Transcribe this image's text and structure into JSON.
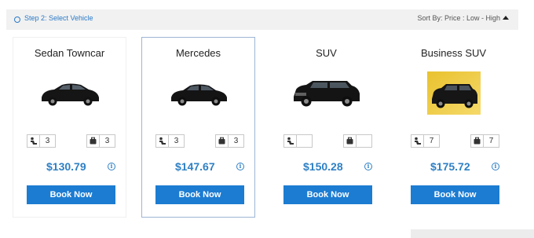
{
  "step": {
    "title": "Step 2: Select Vehicle",
    "sort_label": "Sort By: Price : Low - High"
  },
  "colors": {
    "accent": "#2f80c4",
    "button": "#1c7cd2",
    "selected_border": "#9db5d4"
  },
  "vehicles": [
    {
      "name": "Sedan Towncar",
      "passengers": "3",
      "luggage": "3",
      "price": "$130.79",
      "info": "i",
      "button": "Book Now",
      "selected": false
    },
    {
      "name": "Mercedes",
      "passengers": "3",
      "luggage": "3",
      "price": "$147.67",
      "info": "i",
      "button": "Book Now",
      "selected": true
    },
    {
      "name": "SUV",
      "passengers": "",
      "luggage": "",
      "price": "$150.28",
      "info": "i",
      "button": "Book Now",
      "selected": false
    },
    {
      "name": "Business SUV",
      "passengers": "7",
      "luggage": "7",
      "price": "$175.72",
      "info": "i",
      "button": "Book Now",
      "selected": false
    }
  ],
  "icons": {
    "passenger": "passenger-icon",
    "luggage": "luggage-icon",
    "info": "info-icon",
    "sort": "sort-arrow-icon"
  }
}
